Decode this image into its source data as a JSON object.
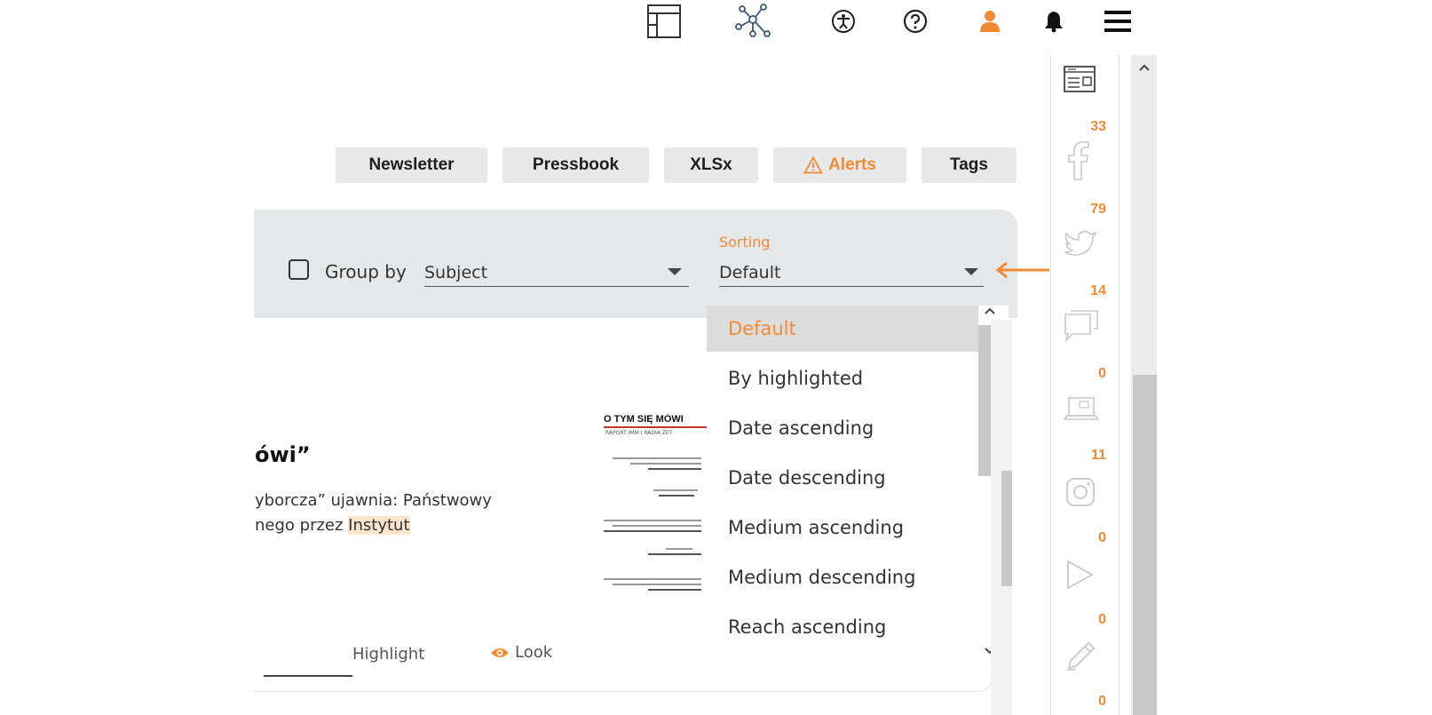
{
  "topbar": {
    "icons": [
      "layout-icon",
      "network-icon",
      "accessibility-icon",
      "help-icon",
      "user-icon",
      "bell-icon",
      "menu-icon"
    ]
  },
  "toolbar": {
    "newsletter_label": "Newsletter",
    "pressbook_label": "Pressbook",
    "xlsx_label": "XLSx",
    "alerts_label": "Alerts",
    "tags_label": "Tags"
  },
  "filters": {
    "group_by_label": "Group by",
    "group_by_checked": false,
    "group_by_value": "Subject",
    "sorting_label": "Sorting",
    "sorting_value": "Default"
  },
  "sort_dropdown": {
    "selected": "Default",
    "options": [
      "Default",
      "By highlighted",
      "Date ascending",
      "Date descending",
      "Medium ascending",
      "Medium descending",
      "Reach ascending"
    ]
  },
  "article": {
    "title_fragment": "ówi”",
    "text_line1": "yborcza” ujawnia: Państwowy",
    "text_line2_pre": "nego przez ",
    "text_line2_highlight": "Instytut",
    "highlight_label": "Highlight",
    "look_label": "Look",
    "thumbnail_title": "O TYM SIĘ MÓWI",
    "thumbnail_subtitle": "RAPORT IMM I RADIA ZET"
  },
  "sidebar": {
    "counts": [
      "33",
      "79",
      "14",
      "0",
      "11",
      "0",
      "0",
      "0"
    ],
    "icons": [
      "newspaper-icon",
      "facebook-icon",
      "twitter-icon",
      "comments-icon",
      "laptop-icon",
      "instagram-icon",
      "play-icon",
      "pencil-icon"
    ]
  },
  "colors": {
    "accent": "#f08a33",
    "panel_bg": "#e5e8eb",
    "button_bg": "#e6e8ea"
  }
}
